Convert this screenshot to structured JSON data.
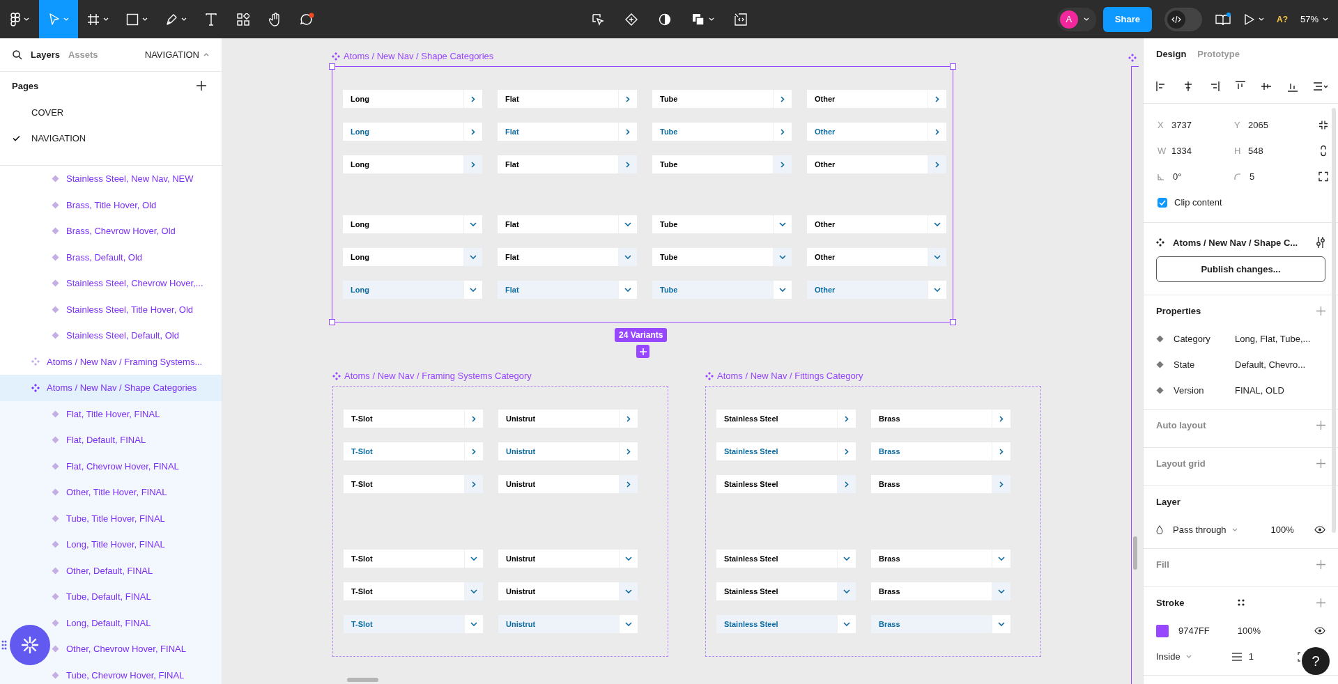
{
  "toolbar": {
    "tools": [
      {
        "kind": "main-menu",
        "selected": false
      },
      {
        "kind": "move",
        "selected": true
      },
      {
        "kind": "frame",
        "selected": false
      },
      {
        "kind": "shape",
        "selected": false
      },
      {
        "kind": "pen",
        "selected": false
      },
      {
        "kind": "text",
        "selected": false
      },
      {
        "kind": "resources",
        "selected": false
      },
      {
        "kind": "hand",
        "selected": false
      },
      {
        "kind": "comment",
        "selected": false
      }
    ],
    "avatar": "A",
    "dev_mode": false,
    "share": "Share",
    "missing_fonts": "A?",
    "zoom": "57%"
  },
  "left_panel": {
    "tabs": [
      {
        "label": "Layers",
        "selected": true
      },
      {
        "label": "Assets",
        "selected": false
      }
    ],
    "page_menu": "NAVIGATION",
    "pages_title": "Pages",
    "pages": [
      {
        "label": "COVER",
        "selected": false
      },
      {
        "label": "NAVIGATION",
        "selected": true
      }
    ],
    "layers": [
      {
        "children": [
          {
            "kind": "variant",
            "label": "Stainless Steel, New Nav, NEW",
            "selected": false
          },
          {
            "kind": "variant",
            "label": "Brass, Title Hover, Old",
            "selected": false
          },
          {
            "kind": "variant",
            "label": "Brass, Chevrow Hover, Old",
            "selected": false
          },
          {
            "kind": "variant",
            "label": "Brass, Default, Old",
            "selected": false
          },
          {
            "kind": "variant",
            "label": "Stainless Steel, Chevrow Hover,...",
            "selected": false
          },
          {
            "kind": "variant",
            "label": "Stainless Steel, Title Hover, Old",
            "selected": false
          },
          {
            "kind": "variant",
            "label": "Stainless Steel, Default, Old",
            "selected": false
          }
        ]
      },
      {
        "kind": "component",
        "label": "Atoms / New Nav / Framing Systems...",
        "selected": false
      },
      {
        "kind": "component",
        "label": "Atoms / New Nav / Shape Categories",
        "selected": true,
        "children": [
          {
            "kind": "variant",
            "label": "Flat, Title Hover, FINAL",
            "selected": false
          },
          {
            "kind": "variant",
            "label": "Flat, Default, FINAL",
            "selected": false
          },
          {
            "kind": "variant",
            "label": "Flat, Chevrow Hover, FINAL",
            "selected": false
          },
          {
            "kind": "variant",
            "label": "Other, Title Hover, FINAL",
            "selected": false
          },
          {
            "kind": "variant",
            "label": "Tube, Title Hover, FINAL",
            "selected": false
          },
          {
            "kind": "variant",
            "label": "Long, Title Hover, FINAL",
            "selected": false
          },
          {
            "kind": "variant",
            "label": "Other, Default, FINAL",
            "selected": false
          },
          {
            "kind": "variant",
            "label": "Tube, Default, FINAL",
            "selected": false
          },
          {
            "kind": "variant",
            "label": "Long, Default, FINAL",
            "selected": false
          },
          {
            "kind": "variant",
            "label": "Other, Chevrow Hover, FINAL",
            "selected": false
          },
          {
            "kind": "variant",
            "label": "Tube, Chevrow Hover, FINAL",
            "selected": false
          }
        ]
      }
    ]
  },
  "canvas": {
    "frames": [
      {
        "title": "Atoms / New Nav / Shape Categories",
        "selected": true,
        "groups": [
          {
            "kind": "chevron_right",
            "rows": [
              {
                "items": [
                  {
                    "label": "Long",
                    "title_hover": false,
                    "chevron_hover": false
                  },
                  {
                    "label": "Flat",
                    "title_hover": false,
                    "chevron_hover": false
                  },
                  {
                    "label": "Tube",
                    "title_hover": false,
                    "chevron_hover": false
                  },
                  {
                    "label": "Other",
                    "title_hover": false,
                    "chevron_hover": false
                  }
                ]
              },
              {
                "items": [
                  {
                    "label": "Long",
                    "title_hover": true,
                    "chevron_hover": false
                  },
                  {
                    "label": "Flat",
                    "title_hover": true,
                    "chevron_hover": false
                  },
                  {
                    "label": "Tube",
                    "title_hover": true,
                    "chevron_hover": false
                  },
                  {
                    "label": "Other",
                    "title_hover": true,
                    "chevron_hover": false
                  }
                ]
              },
              {
                "items": [
                  {
                    "label": "Long",
                    "title_hover": false,
                    "chevron_hover": true
                  },
                  {
                    "label": "Flat",
                    "title_hover": false,
                    "chevron_hover": true
                  },
                  {
                    "label": "Tube",
                    "title_hover": false,
                    "chevron_hover": true
                  },
                  {
                    "label": "Other",
                    "title_hover": false,
                    "chevron_hover": true
                  }
                ]
              }
            ]
          },
          {
            "kind": "chevron_down",
            "rows": [
              {
                "items": [
                  {
                    "label": "Long",
                    "title_hover": false,
                    "chevron_hover": false
                  },
                  {
                    "label": "Flat",
                    "title_hover": false,
                    "chevron_hover": false
                  },
                  {
                    "label": "Tube",
                    "title_hover": false,
                    "chevron_hover": false
                  },
                  {
                    "label": "Other",
                    "title_hover": false,
                    "chevron_hover": false
                  }
                ]
              },
              {
                "items": [
                  {
                    "label": "Long",
                    "title_hover": false,
                    "chevron_hover": true
                  },
                  {
                    "label": "Flat",
                    "title_hover": false,
                    "chevron_hover": true
                  },
                  {
                    "label": "Tube",
                    "title_hover": false,
                    "chevron_hover": true
                  },
                  {
                    "label": "Other",
                    "title_hover": false,
                    "chevron_hover": true
                  }
                ]
              },
              {
                "items": [
                  {
                    "label": "Long",
                    "title_hover": true,
                    "chevron_hover": false
                  },
                  {
                    "label": "Flat",
                    "title_hover": true,
                    "chevron_hover": false
                  },
                  {
                    "label": "Tube",
                    "title_hover": true,
                    "chevron_hover": false
                  },
                  {
                    "label": "Other",
                    "title_hover": true,
                    "chevron_hover": false
                  }
                ]
              }
            ]
          }
        ]
      },
      {
        "title": "Atoms / New Nav / Framing Systems Category",
        "selected": false,
        "groups": [
          {
            "kind": "chevron_right",
            "rows": [
              {
                "items": [
                  {
                    "label": "T-Slot",
                    "title_hover": false,
                    "chevron_hover": false
                  },
                  {
                    "label": "Unistrut",
                    "title_hover": false,
                    "chevron_hover": false
                  }
                ]
              },
              {
                "items": [
                  {
                    "label": "T-Slot",
                    "title_hover": true,
                    "chevron_hover": false
                  },
                  {
                    "label": "Unistrut",
                    "title_hover": true,
                    "chevron_hover": false
                  }
                ]
              },
              {
                "items": [
                  {
                    "label": "T-Slot",
                    "title_hover": false,
                    "chevron_hover": true
                  },
                  {
                    "label": "Unistrut",
                    "title_hover": false,
                    "chevron_hover": true
                  }
                ]
              }
            ]
          },
          {
            "kind": "chevron_down",
            "rows": [
              {
                "items": [
                  {
                    "label": "T-Slot",
                    "title_hover": false,
                    "chevron_hover": false
                  },
                  {
                    "label": "Unistrut",
                    "title_hover": false,
                    "chevron_hover": false
                  }
                ]
              },
              {
                "items": [
                  {
                    "label": "T-Slot",
                    "title_hover": false,
                    "chevron_hover": true
                  },
                  {
                    "label": "Unistrut",
                    "title_hover": false,
                    "chevron_hover": true
                  }
                ]
              },
              {
                "items": [
                  {
                    "label": "T-Slot",
                    "title_hover": true,
                    "chevron_hover": false
                  },
                  {
                    "label": "Unistrut",
                    "title_hover": true,
                    "chevron_hover": false
                  }
                ]
              }
            ]
          }
        ]
      },
      {
        "title": "Atoms / New Nav / Fittings Category",
        "selected": false,
        "groups": [
          {
            "kind": "chevron_right",
            "rows": [
              {
                "items": [
                  {
                    "label": "Stainless Steel",
                    "title_hover": false,
                    "chevron_hover": false
                  },
                  {
                    "label": "Brass",
                    "title_hover": false,
                    "chevron_hover": false
                  }
                ]
              },
              {
                "items": [
                  {
                    "label": "Stainless Steel",
                    "title_hover": true,
                    "chevron_hover": false
                  },
                  {
                    "label": "Brass",
                    "title_hover": true,
                    "chevron_hover": false
                  }
                ]
              },
              {
                "items": [
                  {
                    "label": "Stainless Steel",
                    "title_hover": false,
                    "chevron_hover": true
                  },
                  {
                    "label": "Brass",
                    "title_hover": false,
                    "chevron_hover": true
                  }
                ]
              }
            ]
          },
          {
            "kind": "chevron_down",
            "rows": [
              {
                "items": [
                  {
                    "label": "Stainless Steel",
                    "title_hover": false,
                    "chevron_hover": false
                  },
                  {
                    "label": "Brass",
                    "title_hover": false,
                    "chevron_hover": false
                  }
                ]
              },
              {
                "items": [
                  {
                    "label": "Stainless Steel",
                    "title_hover": false,
                    "chevron_hover": true
                  },
                  {
                    "label": "Brass",
                    "title_hover": false,
                    "chevron_hover": true
                  }
                ]
              },
              {
                "items": [
                  {
                    "label": "Stainless Steel",
                    "title_hover": true,
                    "chevron_hover": false
                  },
                  {
                    "label": "Brass",
                    "title_hover": true,
                    "chevron_hover": false
                  }
                ]
              }
            ]
          }
        ]
      }
    ],
    "variants_badge": "24 Variants"
  },
  "right_panel": {
    "tabs": [
      {
        "label": "Design",
        "selected": true
      },
      {
        "label": "Prototype",
        "selected": false
      }
    ],
    "fields": [
      {
        "label": "X",
        "value": "3737"
      },
      {
        "label": "Y",
        "value": "2065"
      },
      {
        "label": "W",
        "value": "1334"
      },
      {
        "label": "H",
        "value": "548"
      }
    ],
    "rotation": "0°",
    "radius": "5",
    "clip_content": {
      "label": "Clip content",
      "checked": true
    },
    "component_name": "Atoms / New Nav / Shape C...",
    "publish_button": "Publish changes...",
    "sections": [
      {
        "kind": "properties",
        "title": "Properties",
        "items": [
          {
            "name": "Category",
            "value": "Long, Flat, Tube,..."
          },
          {
            "name": "State",
            "value": "Default, Chevro..."
          },
          {
            "name": "Version",
            "value": "FINAL, OLD"
          }
        ]
      },
      {
        "kind": "empty",
        "title": "Auto layout"
      },
      {
        "kind": "empty",
        "title": "Layout grid"
      },
      {
        "kind": "layer",
        "title": "Layer",
        "blend": "Pass through",
        "opacity": "100%"
      },
      {
        "kind": "empty",
        "title": "Fill"
      },
      {
        "kind": "stroke",
        "title": "Stroke",
        "color": "#9747ff",
        "hex": "9747FF",
        "opacity": "100%",
        "position": "Inside",
        "weight": "1"
      }
    ]
  },
  "help_button": "?"
}
